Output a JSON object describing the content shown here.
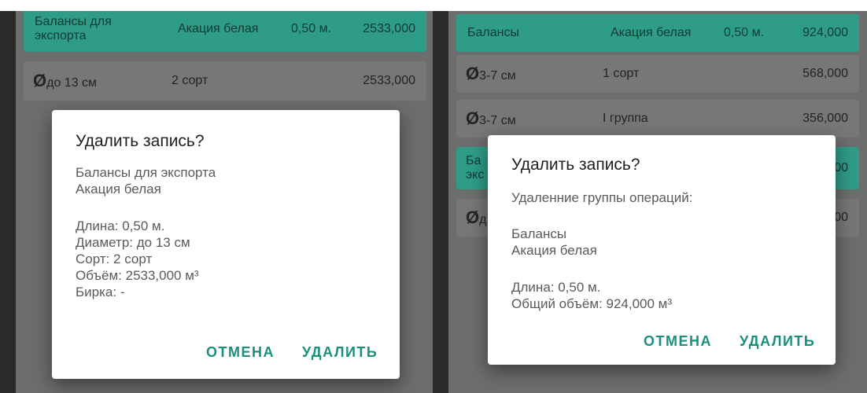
{
  "left": {
    "header_row": {
      "name": "Балансы для экспорта",
      "name_line1": "Балансы для",
      "name_line2": "экспорта",
      "species": "Акация белая",
      "length": "0,50 м.",
      "volume": "2533,000"
    },
    "item_row": {
      "diameter_symbol": "Ø",
      "diameter": "до 13 см",
      "grade": "2 сорт",
      "volume": "2533,000"
    },
    "dialog": {
      "title": "Удалить запись?",
      "lines": [
        "Балансы для экспорта",
        "Акация белая",
        "Длина: 0,50 м.",
        "Диаметр: до 13 см",
        "Сорт: 2 сорт",
        "Объём: 2533,000 м³",
        "Бирка: -"
      ],
      "cancel_label": "ОТМЕНА",
      "delete_label": "УДАЛИТЬ"
    }
  },
  "right": {
    "header_row": {
      "name": "Балансы",
      "species": "Акация белая",
      "length": "0,50 м.",
      "volume": "924,000"
    },
    "rows": [
      {
        "diameter_symbol": "Ø",
        "diameter": "3-7 см",
        "grade": "1 сорт",
        "volume": "568,000"
      },
      {
        "diameter_symbol": "Ø",
        "diameter": "3-7 см",
        "grade": "I группа",
        "volume": "356,000"
      }
    ],
    "partial_header": {
      "left_text_1": "Ба",
      "left_text_2": "экс",
      "right_text": "00"
    },
    "partial_item": {
      "diameter_symbol": "Ø",
      "left_text": "д",
      "right_text": "00"
    },
    "dialog": {
      "title": "Удалить запись?",
      "lines": [
        "Удаленние группы операций:",
        "Балансы",
        "Акация белая",
        "Длина: 0,50 м.",
        "Общий объём: 924,000 м³"
      ],
      "cancel_label": "ОТМЕНА",
      "delete_label": "УДАЛИТЬ"
    }
  },
  "colors": {
    "accent": "#2f9c88",
    "button_text": "#1a8f7c",
    "scrim": "#6d6d6d"
  }
}
